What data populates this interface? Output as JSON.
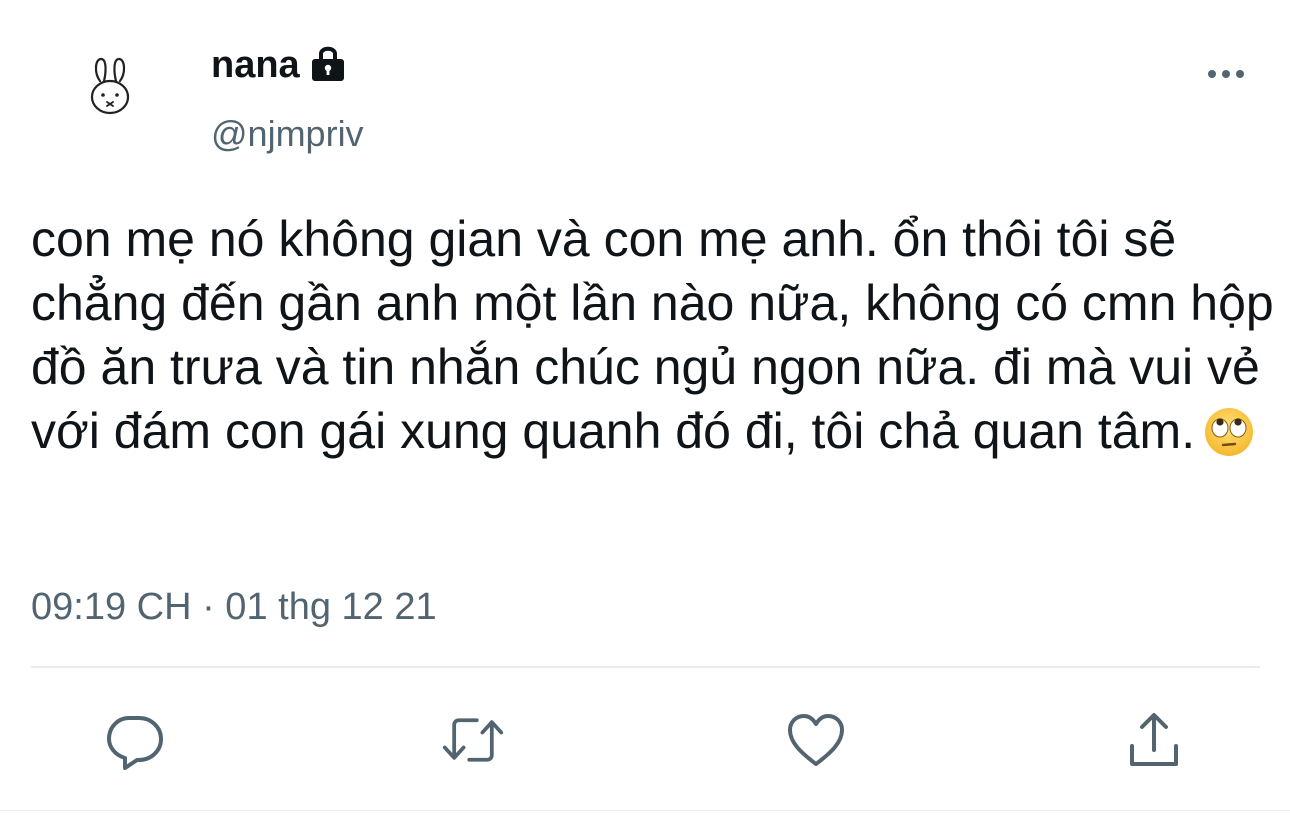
{
  "tweet": {
    "display_name": "nana",
    "handle": "@njmpriv",
    "text": "con mẹ nó không gian và con mẹ anh. ổn thôi tôi sẽ chẳng đến gần anh một lần nào nữa, không có cmn hộp đồ ăn trưa và tin nhắn chúc ngủ ngon nữa. đi mà vui vẻ với đám con gái xung quanh đó đi, tôi chả quan tâm.",
    "emoji": "face-with-rolling-eyes",
    "timestamp": "09:19 CH · 01 thg 12 21"
  },
  "icons": {
    "avatar": "bunny-icon",
    "protected": "lock-icon",
    "more": "more-icon",
    "reply": "reply-icon",
    "retweet": "retweet-icon",
    "like": "heart-icon",
    "share": "share-icon"
  },
  "colors": {
    "text": "#0f1419",
    "secondary": "#536471",
    "divider": "#e6ecf0"
  }
}
